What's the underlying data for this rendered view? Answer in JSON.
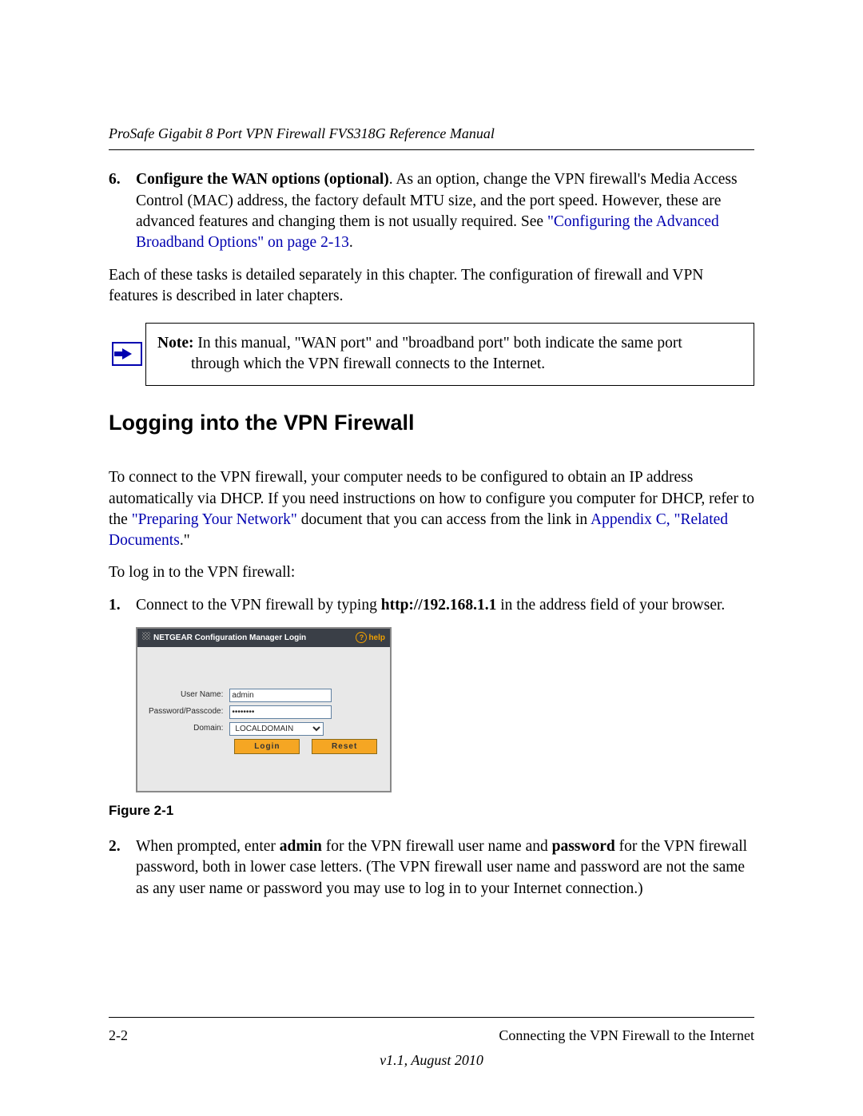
{
  "header": {
    "running_title": "ProSafe Gigabit 8 Port VPN Firewall FVS318G Reference Manual"
  },
  "item6": {
    "num": "6.",
    "lead_bold": "Configure the WAN options (optional)",
    "rest": ". As an option, change the VPN firewall's Media Access Control (MAC) address, the factory default MTU size, and the port speed. However, these are advanced features and changing them is not usually required. See ",
    "xref": "\"Configuring the Advanced Broadband Options\" on page 2-13",
    "tail": "."
  },
  "para_after6": "Each of these tasks is detailed separately in this chapter. The configuration of firewall and VPN features is described in later chapters.",
  "note": {
    "label": "Note:",
    "line1": " In this manual, \"WAN port\" and \"broadband port\" both indicate the same port",
    "line2": "through which the VPN firewall connects to the Internet."
  },
  "section_heading": "Logging into the VPN Firewall",
  "intro": {
    "p1a": "To connect to the VPN firewall, your computer needs to be configured to obtain an IP address automatically via DHCP. If you need instructions on how to configure you computer for DHCP, refer to the ",
    "link1": "\"Preparing Your Network\"",
    "p1b": " document that you can access from the link in ",
    "link2": "Appendix C, \"Related Documents",
    "p1c": ".\""
  },
  "to_login": "To log in to the VPN firewall:",
  "step1": {
    "num": "1.",
    "a": "Connect to the VPN firewall by typing ",
    "url": "http://192.168.1.1",
    "b": " in the address field of your browser."
  },
  "login_ui": {
    "title": "NETGEAR Configuration Manager Login",
    "help": "help",
    "labels": {
      "user": "User Name:",
      "pass": "Password/Passcode:",
      "domain": "Domain:"
    },
    "values": {
      "user": "admin",
      "pass": "••••••••",
      "domain": "LOCALDOMAIN"
    },
    "buttons": {
      "login": "Login",
      "reset": "Reset"
    }
  },
  "figure_caption": "Figure 2-1",
  "step2": {
    "num": "2.",
    "a": "When prompted, enter ",
    "b1": "admin",
    "c": " for the VPN firewall user name and ",
    "b2": "password",
    "d": " for the VPN firewall password, both in lower case letters. (The VPN firewall user name and password are not the same as any user name or password you may use to log in to your Internet connection.)"
  },
  "footer": {
    "page": "2-2",
    "chapter": "Connecting the VPN Firewall to the Internet",
    "version": "v1.1, August 2010"
  }
}
